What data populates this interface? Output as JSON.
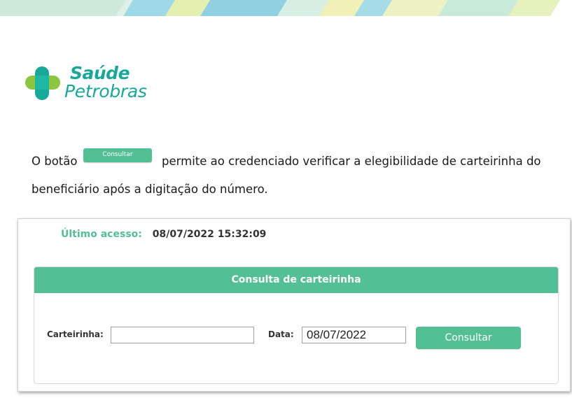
{
  "brand": {
    "name_line1": "Saúde",
    "name_line2": "Petrobras",
    "accent_color": "#17a89a",
    "button_color": "#52bf94"
  },
  "description": {
    "before_button": "O botão",
    "inline_button_label": "Consultar",
    "after_button": "permite ao credenciado verificar a elegibilidade de carteirinha do",
    "line2": "beneficiário após a digitação do número."
  },
  "screen": {
    "last_access_label": "Último acesso:",
    "last_access_value": "08/07/2022 15:32:09",
    "panel_title": "Consulta de carteirinha",
    "card_label": "Carteirinha:",
    "card_value": "",
    "date_label": "Data:",
    "date_value": "08/07/2022",
    "submit_label": "Consultar"
  }
}
